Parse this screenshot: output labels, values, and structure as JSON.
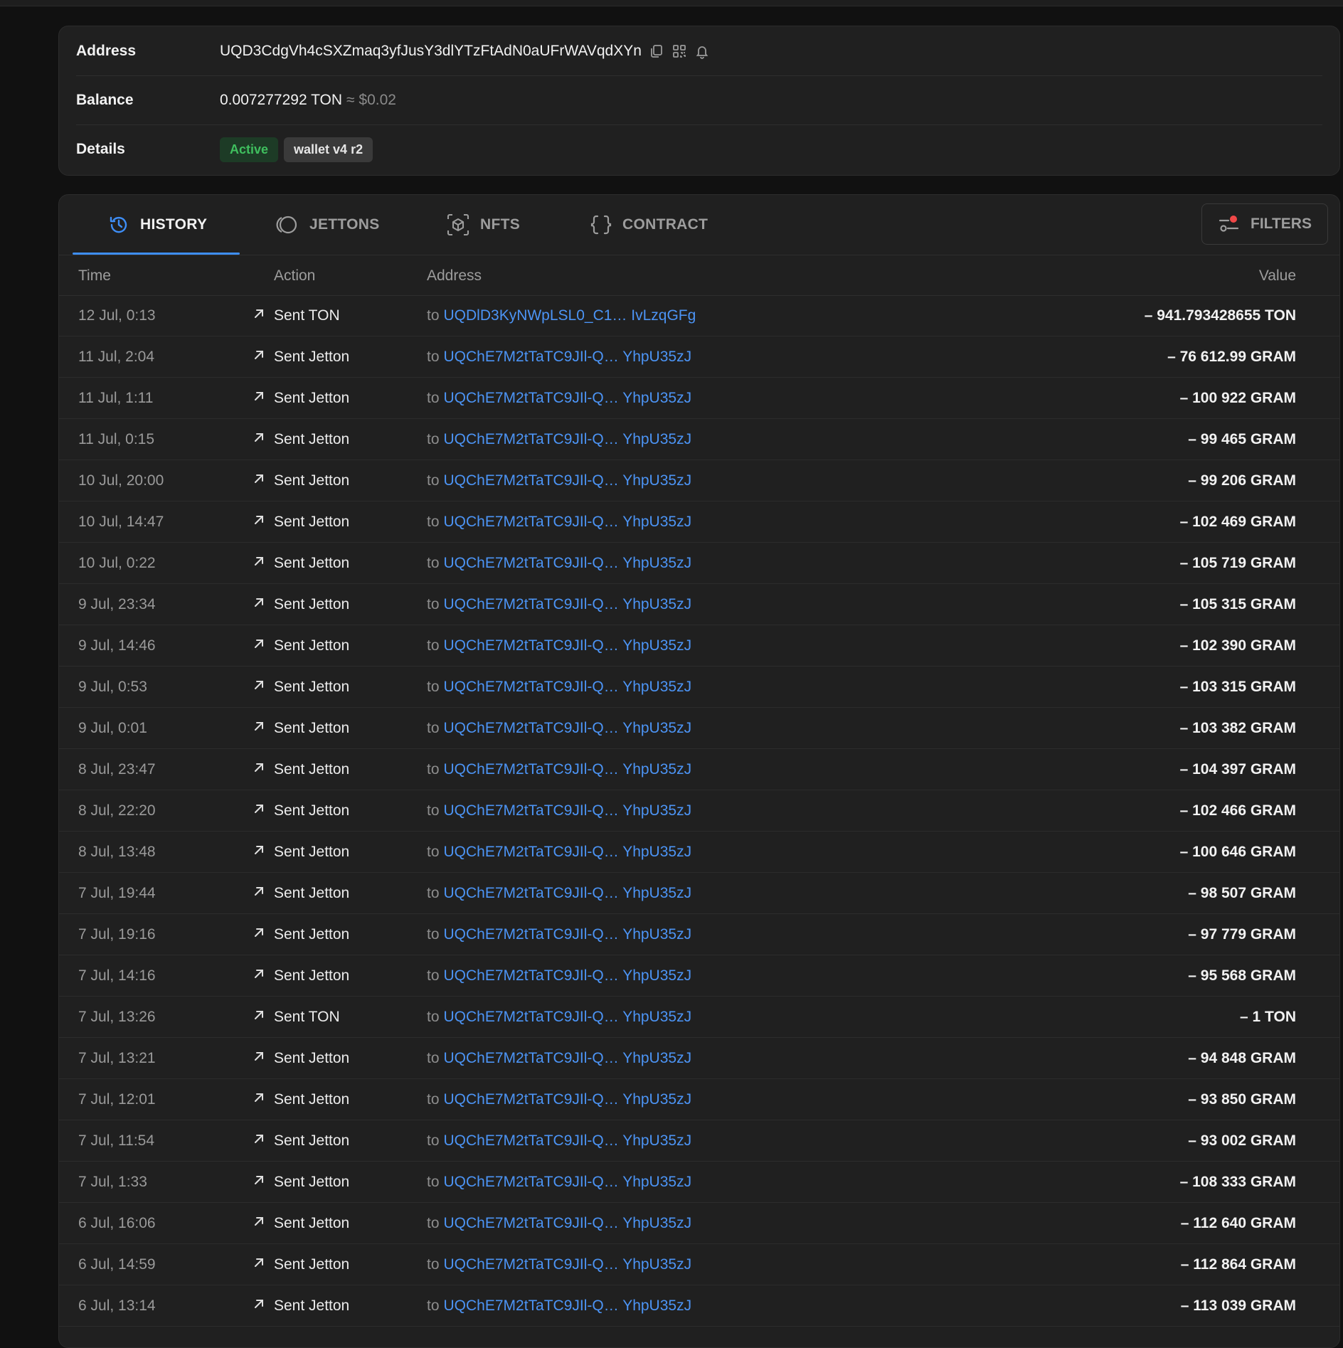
{
  "info": {
    "address_label": "Address",
    "address_value": "UQD3CdgVh4cSXZmaq3yfJusY3dlYTzFtAdN0aUFrWAVqdXYn",
    "balance_label": "Balance",
    "balance_value": "0.007277292 TON",
    "balance_usd": "≈ $0.02",
    "details_label": "Details",
    "status_badge": "Active",
    "wallet_badge": "wallet v4 r2"
  },
  "tabs": [
    {
      "label": "HISTORY",
      "icon": "history-icon",
      "active": true
    },
    {
      "label": "JETTONS",
      "icon": "coin-icon",
      "active": false
    },
    {
      "label": "NFTS",
      "icon": "cube-icon",
      "active": false
    },
    {
      "label": "CONTRACT",
      "icon": "braces-icon",
      "active": false
    }
  ],
  "filters_label": "FILTERS",
  "colors": {
    "accent": "#3e8ef7",
    "link": "#4c94f5",
    "active_green": "#3fbf5e",
    "filter_dot": "#f04848"
  },
  "table": {
    "headers": {
      "time": "Time",
      "action": "Action",
      "address": "Address",
      "value": "Value"
    },
    "rows": [
      {
        "time": "12 Jul, 0:13",
        "action": "Sent TON",
        "to": "to",
        "address": "UQDlD3KyNWpLSL0_C1… IvLzqGFg",
        "value": "– 941.793428655 TON"
      },
      {
        "time": "11 Jul, 2:04",
        "action": "Sent Jetton",
        "to": "to",
        "address": "UQChE7M2tTaTC9JIl-Q… YhpU35zJ",
        "value": "– 76 612.99 GRAM"
      },
      {
        "time": "11 Jul, 1:11",
        "action": "Sent Jetton",
        "to": "to",
        "address": "UQChE7M2tTaTC9JIl-Q… YhpU35zJ",
        "value": "– 100 922 GRAM"
      },
      {
        "time": "11 Jul, 0:15",
        "action": "Sent Jetton",
        "to": "to",
        "address": "UQChE7M2tTaTC9JIl-Q… YhpU35zJ",
        "value": "– 99 465 GRAM"
      },
      {
        "time": "10 Jul, 20:00",
        "action": "Sent Jetton",
        "to": "to",
        "address": "UQChE7M2tTaTC9JIl-Q… YhpU35zJ",
        "value": "– 99 206 GRAM"
      },
      {
        "time": "10 Jul, 14:47",
        "action": "Sent Jetton",
        "to": "to",
        "address": "UQChE7M2tTaTC9JIl-Q… YhpU35zJ",
        "value": "– 102 469 GRAM"
      },
      {
        "time": "10 Jul, 0:22",
        "action": "Sent Jetton",
        "to": "to",
        "address": "UQChE7M2tTaTC9JIl-Q… YhpU35zJ",
        "value": "– 105 719 GRAM"
      },
      {
        "time": "9 Jul, 23:34",
        "action": "Sent Jetton",
        "to": "to",
        "address": "UQChE7M2tTaTC9JIl-Q… YhpU35zJ",
        "value": "– 105 315 GRAM"
      },
      {
        "time": "9 Jul, 14:46",
        "action": "Sent Jetton",
        "to": "to",
        "address": "UQChE7M2tTaTC9JIl-Q… YhpU35zJ",
        "value": "– 102 390 GRAM"
      },
      {
        "time": "9 Jul, 0:53",
        "action": "Sent Jetton",
        "to": "to",
        "address": "UQChE7M2tTaTC9JIl-Q… YhpU35zJ",
        "value": "– 103 315 GRAM"
      },
      {
        "time": "9 Jul, 0:01",
        "action": "Sent Jetton",
        "to": "to",
        "address": "UQChE7M2tTaTC9JIl-Q… YhpU35zJ",
        "value": "– 103 382 GRAM"
      },
      {
        "time": "8 Jul, 23:47",
        "action": "Sent Jetton",
        "to": "to",
        "address": "UQChE7M2tTaTC9JIl-Q… YhpU35zJ",
        "value": "– 104 397 GRAM"
      },
      {
        "time": "8 Jul, 22:20",
        "action": "Sent Jetton",
        "to": "to",
        "address": "UQChE7M2tTaTC9JIl-Q… YhpU35zJ",
        "value": "– 102 466 GRAM"
      },
      {
        "time": "8 Jul, 13:48",
        "action": "Sent Jetton",
        "to": "to",
        "address": "UQChE7M2tTaTC9JIl-Q… YhpU35zJ",
        "value": "– 100 646 GRAM"
      },
      {
        "time": "7 Jul, 19:44",
        "action": "Sent Jetton",
        "to": "to",
        "address": "UQChE7M2tTaTC9JIl-Q… YhpU35zJ",
        "value": "– 98 507 GRAM"
      },
      {
        "time": "7 Jul, 19:16",
        "action": "Sent Jetton",
        "to": "to",
        "address": "UQChE7M2tTaTC9JIl-Q… YhpU35zJ",
        "value": "– 97 779 GRAM"
      },
      {
        "time": "7 Jul, 14:16",
        "action": "Sent Jetton",
        "to": "to",
        "address": "UQChE7M2tTaTC9JIl-Q… YhpU35zJ",
        "value": "– 95 568 GRAM"
      },
      {
        "time": "7 Jul, 13:26",
        "action": "Sent TON",
        "to": "to",
        "address": "UQChE7M2tTaTC9JIl-Q… YhpU35zJ",
        "value": "– 1 TON"
      },
      {
        "time": "7 Jul, 13:21",
        "action": "Sent Jetton",
        "to": "to",
        "address": "UQChE7M2tTaTC9JIl-Q… YhpU35zJ",
        "value": "– 94 848 GRAM"
      },
      {
        "time": "7 Jul, 12:01",
        "action": "Sent Jetton",
        "to": "to",
        "address": "UQChE7M2tTaTC9JIl-Q… YhpU35zJ",
        "value": "– 93 850 GRAM"
      },
      {
        "time": "7 Jul, 11:54",
        "action": "Sent Jetton",
        "to": "to",
        "address": "UQChE7M2tTaTC9JIl-Q… YhpU35zJ",
        "value": "– 93 002 GRAM"
      },
      {
        "time": "7 Jul, 1:33",
        "action": "Sent Jetton",
        "to": "to",
        "address": "UQChE7M2tTaTC9JIl-Q… YhpU35zJ",
        "value": "– 108 333 GRAM"
      },
      {
        "time": "6 Jul, 16:06",
        "action": "Sent Jetton",
        "to": "to",
        "address": "UQChE7M2tTaTC9JIl-Q… YhpU35zJ",
        "value": "– 112 640 GRAM"
      },
      {
        "time": "6 Jul, 14:59",
        "action": "Sent Jetton",
        "to": "to",
        "address": "UQChE7M2tTaTC9JIl-Q… YhpU35zJ",
        "value": "– 112 864 GRAM"
      },
      {
        "time": "6 Jul, 13:14",
        "action": "Sent Jetton",
        "to": "to",
        "address": "UQChE7M2tTaTC9JIl-Q… YhpU35zJ",
        "value": "– 113 039 GRAM"
      }
    ]
  }
}
